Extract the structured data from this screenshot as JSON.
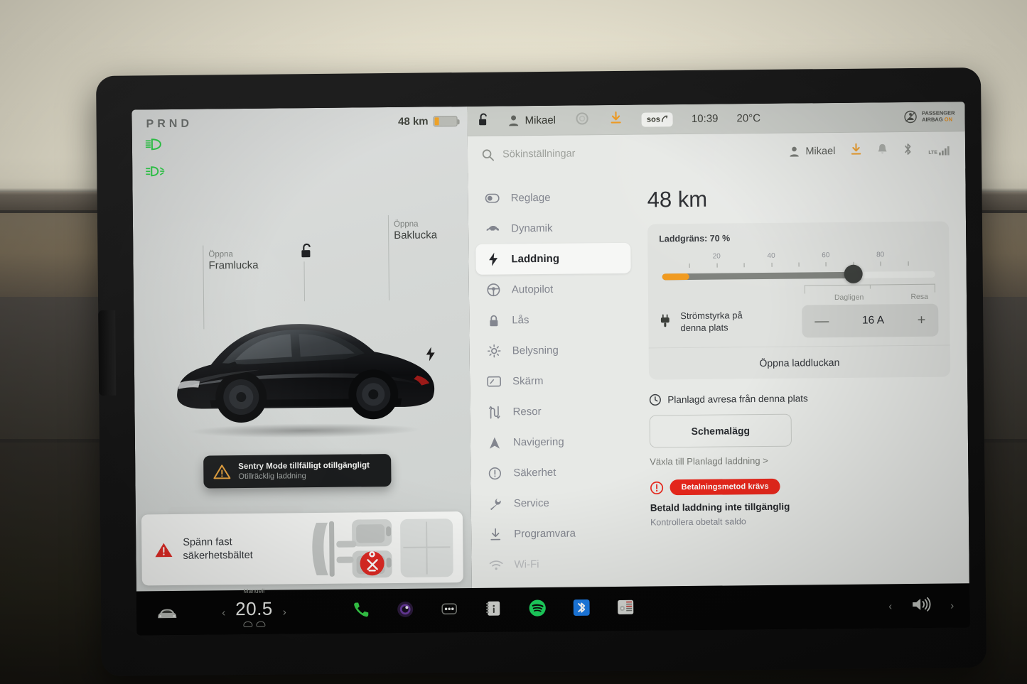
{
  "vehicle_display": {
    "gear_indicator": "PRND",
    "range_top": "48 km",
    "battery_percent": 18,
    "lamp_icons": [
      "low-beam-headlight-icon",
      "fog-light-icon"
    ],
    "front_trunk": {
      "action": "Öppna",
      "name": "Framlucka"
    },
    "rear_trunk": {
      "action": "Öppna",
      "name": "Baklucka"
    },
    "lock_icon": "unlocked-padlock-icon",
    "charge_port_icon": "lightning-bolt-icon",
    "toast": {
      "title": "Sentry Mode tillfälligt otillgängligt",
      "subtitle": "Otillräcklig laddning",
      "icon": "warning-triangle-icon"
    },
    "seatbelt_alert": {
      "line1": "Spänn fast",
      "line2": "säkerhetsbältet",
      "icon": "red-warning-triangle-icon"
    }
  },
  "statusbar": {
    "lock_icon": "unlocked-padlock-icon",
    "profile_icon": "person-icon",
    "profile_name": "Mikael",
    "circle_icon": "circle-icon",
    "download_icon": "download-arrow-icon",
    "sos_label": "sos",
    "time": "10:39",
    "temperature": "20°C",
    "airbag": {
      "line1": "PASSENGER",
      "line2": "AIRBAG",
      "state": "ON"
    }
  },
  "search": {
    "placeholder": "Sökinställningar",
    "icon": "search-icon",
    "profile_name": "Mikael",
    "icons": [
      "download-arrow-icon",
      "bell-icon",
      "bluetooth-icon",
      "lte-signal-icon"
    ],
    "network_label": "LTE"
  },
  "sidebar": {
    "items": [
      {
        "label": "Reglage",
        "icon": "toggle-switch-icon",
        "active": false
      },
      {
        "label": "Dynamik",
        "icon": "car-side-icon",
        "active": false
      },
      {
        "label": "Laddning",
        "icon": "lightning-bolt-icon",
        "active": true
      },
      {
        "label": "Autopilot",
        "icon": "steering-wheel-icon",
        "active": false
      },
      {
        "label": "Lås",
        "icon": "padlock-icon",
        "active": false
      },
      {
        "label": "Belysning",
        "icon": "sun-brightness-icon",
        "active": false
      },
      {
        "label": "Skärm",
        "icon": "display-icon",
        "active": false
      },
      {
        "label": "Resor",
        "icon": "route-icon",
        "active": false
      },
      {
        "label": "Navigering",
        "icon": "navigation-arrow-icon",
        "active": false
      },
      {
        "label": "Säkerhet",
        "icon": "exclamation-circle-icon",
        "active": false
      },
      {
        "label": "Service",
        "icon": "wrench-icon",
        "active": false
      },
      {
        "label": "Programvara",
        "icon": "download-arrow-icon",
        "active": false
      },
      {
        "label": "Wi-Fi",
        "icon": "wifi-icon",
        "active": false
      }
    ]
  },
  "charging": {
    "range_heading": "48 km",
    "limit_label": "Laddgräns: 70 %",
    "limit_percent": 70,
    "current_charge_percent": 10,
    "slider_ticks": [
      10,
      20,
      30,
      40,
      50,
      60,
      70,
      80,
      90
    ],
    "slider_numbers": [
      {
        "value": 20,
        "label": "20"
      },
      {
        "value": 40,
        "label": "40"
      },
      {
        "value": 60,
        "label": "60"
      },
      {
        "value": 80,
        "label": "80"
      }
    ],
    "mode_labels": {
      "daily": "Dagligen",
      "trip": "Resa"
    },
    "amperage": {
      "label_line1": "Strömstyrka på",
      "label_line2": "denna plats",
      "icon": "charge-plug-icon",
      "value": "16  A",
      "minus": "—",
      "plus": "+"
    },
    "open_port_button": "Öppna laddluckan",
    "scheduled": {
      "header": "Planlagd avresa från denna plats",
      "icon": "clock-icon",
      "button": "Schemalägg",
      "switch_link": "Växla till Planlagd laddning >"
    },
    "payment": {
      "badge": "Betalningsmetod krävs",
      "icon": "exclamation-circle-icon",
      "title": "Betald laddning inte tillgänglig",
      "subtitle": "Kontrollera obetalt saldo"
    },
    "accent_orange": "#f09a1f",
    "alert_red": "#e8271c"
  },
  "dock": {
    "car_icon": "car-front-icon",
    "climate": {
      "mode": "Manuell",
      "temperature": "20.5",
      "left_chevron": "‹",
      "right_chevron": "›",
      "vent_icons": [
        "windshield-vent-icon",
        "face-vent-icon"
      ]
    },
    "apps": [
      {
        "name": "phone-icon"
      },
      {
        "name": "camera-icon"
      },
      {
        "name": "more-dots-icon"
      },
      {
        "name": "owners-manual-icon"
      },
      {
        "name": "spotify-icon"
      },
      {
        "name": "bluetooth-icon"
      },
      {
        "name": "radio-tuner-icon"
      }
    ],
    "volume": {
      "left_chevron": "‹",
      "icon": "speaker-volume-icon",
      "right_chevron": "›"
    }
  }
}
